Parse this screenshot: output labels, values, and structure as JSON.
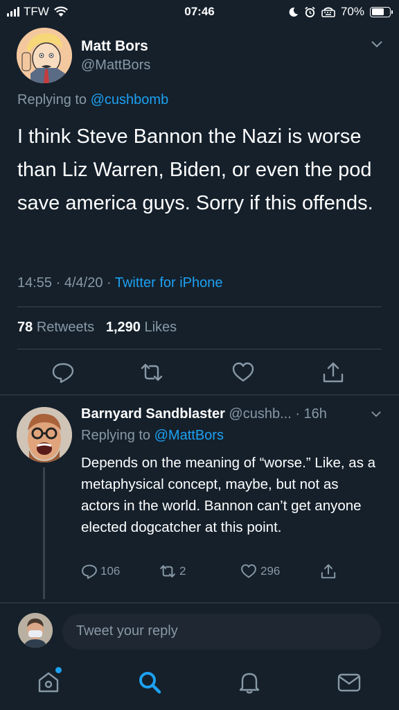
{
  "status_bar": {
    "carrier": "TFW",
    "time": "07:46",
    "battery": "70%",
    "battery_level": 0.7
  },
  "main_tweet": {
    "author_name": "Matt Bors",
    "author_handle": "@MattBors",
    "replying_prefix": "Replying to",
    "replying_to": "@cushbomb",
    "text": "I think Steve Bannon the Nazi is worse than Liz Warren, Biden, or even the pod save america guys. Sorry if this offends.",
    "time": "14:55",
    "date": "4/4/20",
    "source": "Twitter for iPhone",
    "retweet_count": "78",
    "retweet_label": "Retweets",
    "like_count": "1,290",
    "like_label": "Likes",
    "icons": [
      "reply-icon",
      "retweet-icon",
      "like-icon",
      "share-icon"
    ]
  },
  "reply_tweet": {
    "author_name": "Barnyard Sandblaster",
    "author_handle": "@cushb...",
    "age": "16h",
    "replying_prefix": "Replying to",
    "replying_to": "@MattBors",
    "text": "Depends on the meaning of “worse.” Like, as a metaphysical concept, maybe, but not as actors in the world. Bannon can’t get anyone elected dogcatcher at this point.",
    "reply_count": "106",
    "retweet_count": "2",
    "like_count": "296"
  },
  "compose": {
    "placeholder": "Tweet your reply"
  },
  "tab_bar": {
    "items": [
      "home-icon",
      "search-icon",
      "notifications-icon",
      "messages-icon"
    ],
    "active": "search-icon"
  },
  "colors": {
    "background": "#15202b",
    "accent": "#1da1f2",
    "muted": "#8899a6",
    "divider": "#38444d"
  }
}
